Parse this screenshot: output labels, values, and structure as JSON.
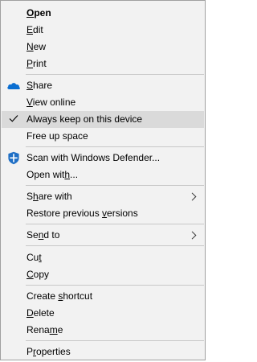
{
  "menu": {
    "items": [
      {
        "pre": "",
        "acc": "O",
        "post": "pen",
        "bold": true
      },
      {
        "pre": "",
        "acc": "E",
        "post": "dit"
      },
      {
        "pre": "",
        "acc": "N",
        "post": "ew"
      },
      {
        "pre": "",
        "acc": "P",
        "post": "rint"
      },
      {
        "pre": "",
        "acc": "S",
        "post": "hare",
        "icon": "onedrive-cloud-icon"
      },
      {
        "pre": "",
        "acc": "V",
        "post": "iew online"
      },
      {
        "pre": "Always keep on this device",
        "acc": "",
        "post": "",
        "icon": "checkmark-icon",
        "highlighted": true
      },
      {
        "pre": "Free up space",
        "acc": "",
        "post": ""
      },
      {
        "pre": "Scan with Windows Defender...",
        "acc": "",
        "post": "",
        "icon": "windows-defender-shield-icon"
      },
      {
        "pre": "Open wit",
        "acc": "h",
        "post": "..."
      },
      {
        "pre": "S",
        "acc": "h",
        "post": "are with",
        "submenu": "chevron-right-icon"
      },
      {
        "pre": "Restore previous ",
        "acc": "v",
        "post": "ersions"
      },
      {
        "pre": "Se",
        "acc": "n",
        "post": "d to",
        "submenu": "chevron-right-icon"
      },
      {
        "pre": "Cu",
        "acc": "t",
        "post": ""
      },
      {
        "pre": "",
        "acc": "C",
        "post": "opy"
      },
      {
        "pre": "Create ",
        "acc": "s",
        "post": "hortcut"
      },
      {
        "pre": "",
        "acc": "D",
        "post": "elete"
      },
      {
        "pre": "Rena",
        "acc": "m",
        "post": "e"
      },
      {
        "pre": "P",
        "acc": "r",
        "post": "operties"
      }
    ]
  },
  "colors": {
    "menu_bg": "#f2f2f2",
    "highlight": "#dadada",
    "onedrive_blue": "#0a6ed1",
    "defender_blue": "#1f6fc5"
  }
}
